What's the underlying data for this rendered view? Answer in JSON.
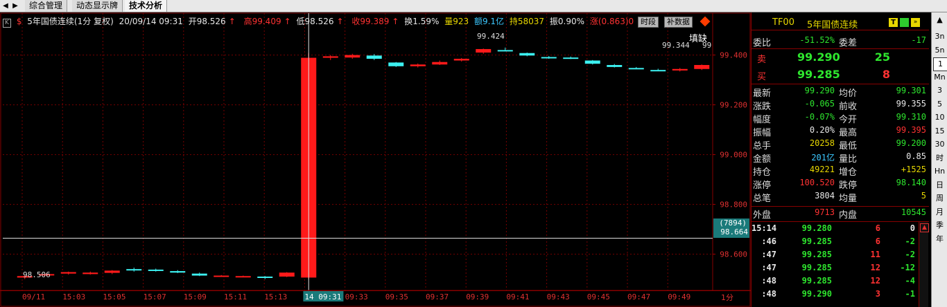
{
  "tabs": [
    "综合管理",
    "动态显示牌",
    "技术分析"
  ],
  "chart": {
    "symbol": "5年国债连续(1分 复权)",
    "date": "20/09/14 09:31",
    "open": "开98.526",
    "high": "高99.409",
    "low": "低98.526",
    "close": "收99.389",
    "turnover": "换1.59%",
    "volume": "量923",
    "amount": "额9.1亿",
    "hold": "持58037",
    "amplitude": "振0.90%",
    "change": "涨(0.863)0",
    "btn_period": "时段",
    "btn_fill": "补数据",
    "fill_gap": "填缺",
    "crosshair_left_label": "(7894)",
    "crosshair_price": "98.664",
    "annot_high": "99.424",
    "annot_right": "99.344",
    "annot_right_trunc": "99",
    "annot_low": "98.506",
    "y_ticks": [
      "99.400",
      "99.200",
      "99.000",
      "98.800",
      "98.600"
    ],
    "x_ticks": [
      "09/11",
      "15:03",
      "15:05",
      "15:07",
      "15:09",
      "15:11",
      "15:13",
      "14 09:31",
      "09:33",
      "09:35",
      "09:37",
      "09:39",
      "09:41",
      "09:43",
      "09:45",
      "09:47",
      "09:49"
    ],
    "period_label": "1分",
    "candles": [
      {
        "o": 98.506,
        "c": 98.512,
        "h": 98.515,
        "l": 98.5
      },
      {
        "o": 98.515,
        "c": 98.52,
        "h": 98.524,
        "l": 98.512
      },
      {
        "o": 98.522,
        "c": 98.528,
        "h": 98.53,
        "l": 98.518
      },
      {
        "o": 98.52,
        "c": 98.526,
        "h": 98.53,
        "l": 98.518
      },
      {
        "o": 98.525,
        "c": 98.534,
        "h": 98.536,
        "l": 98.52
      },
      {
        "o": 98.54,
        "c": 98.536,
        "h": 98.546,
        "l": 98.53
      },
      {
        "o": 98.538,
        "c": 98.534,
        "h": 98.542,
        "l": 98.53
      },
      {
        "o": 98.532,
        "c": 98.526,
        "h": 98.536,
        "l": 98.524
      },
      {
        "o": 98.522,
        "c": 98.514,
        "h": 98.526,
        "l": 98.512
      },
      {
        "o": 98.512,
        "c": 98.514,
        "h": 98.516,
        "l": 98.51
      },
      {
        "o": 98.51,
        "c": 98.512,
        "h": 98.514,
        "l": 98.508
      },
      {
        "o": 98.51,
        "c": 98.508,
        "h": 98.512,
        "l": 98.5
      },
      {
        "o": 98.51,
        "c": 98.526,
        "h": 98.528,
        "l": 98.508
      },
      {
        "o": 98.506,
        "c": 99.389,
        "h": 99.409,
        "l": 98.5
      },
      {
        "o": 99.389,
        "c": 99.395,
        "h": 99.4,
        "l": 99.38
      },
      {
        "o": 99.39,
        "c": 99.4,
        "h": 99.405,
        "l": 99.385
      },
      {
        "o": 99.398,
        "c": 99.385,
        "h": 99.404,
        "l": 99.38
      },
      {
        "o": 99.37,
        "c": 99.355,
        "h": 99.372,
        "l": 99.352
      },
      {
        "o": 99.355,
        "c": 99.362,
        "h": 99.366,
        "l": 99.35
      },
      {
        "o": 99.362,
        "c": 99.372,
        "h": 99.378,
        "l": 99.36
      },
      {
        "o": 99.378,
        "c": 99.385,
        "h": 99.388,
        "l": 99.374
      },
      {
        "o": 99.41,
        "c": 99.424,
        "h": 99.426,
        "l": 99.405
      },
      {
        "o": 99.42,
        "c": 99.418,
        "h": 99.43,
        "l": 99.415
      },
      {
        "o": 99.408,
        "c": 99.398,
        "h": 99.41,
        "l": 99.395
      },
      {
        "o": 99.392,
        "c": 99.39,
        "h": 99.396,
        "l": 99.385
      },
      {
        "o": 99.39,
        "c": 99.388,
        "h": 99.394,
        "l": 99.384
      },
      {
        "o": 99.378,
        "c": 99.365,
        "h": 99.38,
        "l": 99.362
      },
      {
        "o": 99.36,
        "c": 99.352,
        "h": 99.364,
        "l": 99.35
      },
      {
        "o": 99.348,
        "c": 99.346,
        "h": 99.352,
        "l": 99.344
      },
      {
        "o": 99.34,
        "c": 99.338,
        "h": 99.345,
        "l": 99.335
      },
      {
        "o": 99.338,
        "c": 99.344,
        "h": 99.348,
        "l": 99.334
      },
      {
        "o": 99.344,
        "c": 99.36,
        "h": 99.362,
        "l": 99.34
      }
    ]
  },
  "panel": {
    "code": "TF00",
    "name": "5年国债连续",
    "weibi_label": "委比",
    "weibi": "-51.52%",
    "weicha_label": "委差",
    "weicha": "-17",
    "sell_label": "卖",
    "sell_price": "99.290",
    "sell_qty": "25",
    "buy_label": "买",
    "buy_price": "99.285",
    "buy_qty": "8",
    "stats": [
      {
        "l1": "最新",
        "v1": "99.290",
        "c1": "green",
        "l2": "均价",
        "v2": "99.301",
        "c2": "green"
      },
      {
        "l1": "涨跌",
        "v1": "-0.065",
        "c1": "green",
        "l2": "前收",
        "v2": "99.355",
        "c2": "white"
      },
      {
        "l1": "幅度",
        "v1": "-0.07%",
        "c1": "green",
        "l2": "今开",
        "v2": "99.310",
        "c2": "green"
      },
      {
        "l1": "振幅",
        "v1": "0.20%",
        "c1": "white",
        "l2": "最高",
        "v2": "99.395",
        "c2": "red"
      },
      {
        "l1": "总手",
        "v1": "20258",
        "c1": "yellow",
        "l2": "最低",
        "v2": "99.200",
        "c2": "green"
      },
      {
        "l1": "金额",
        "v1": "201亿",
        "c1": "cyan",
        "l2": "量比",
        "v2": "0.85",
        "c2": "white"
      },
      {
        "l1": "持仓",
        "v1": "49221",
        "c1": "yellow",
        "l2": "增仓",
        "v2": "+1525",
        "c2": "yellow"
      },
      {
        "l1": "涨停",
        "v1": "100.520",
        "c1": "red",
        "l2": "跌停",
        "v2": "98.140",
        "c2": "green"
      },
      {
        "l1": "总笔",
        "v1": "3804",
        "c1": "white",
        "l2": "均量",
        "v2": "5",
        "c2": "yellow"
      }
    ],
    "outer_label": "外盘",
    "outer": "9713",
    "inner_label": "内盘",
    "inner": "10545",
    "ticks": [
      {
        "t": "15:14",
        "p": "99.280",
        "q": "6",
        "d": "0",
        "dc": "white"
      },
      {
        "t": ":46",
        "p": "99.285",
        "q": "6",
        "d": "-2",
        "dc": "green"
      },
      {
        "t": ":47",
        "p": "99.285",
        "q": "11",
        "d": "-2",
        "dc": "green"
      },
      {
        "t": ":47",
        "p": "99.285",
        "q": "12",
        "d": "-12",
        "dc": "green"
      },
      {
        "t": ":48",
        "p": "99.285",
        "q": "12",
        "d": "-4",
        "dc": "green"
      },
      {
        "t": ":48",
        "p": "99.290",
        "q": "3",
        "d": "-1",
        "dc": "green"
      }
    ]
  },
  "sidebar": [
    "3n",
    "5n",
    "1",
    "Mn",
    "3",
    "5",
    "10",
    "15",
    "30",
    "时",
    "Hn",
    "日",
    "周",
    "月",
    "季",
    "年"
  ]
}
